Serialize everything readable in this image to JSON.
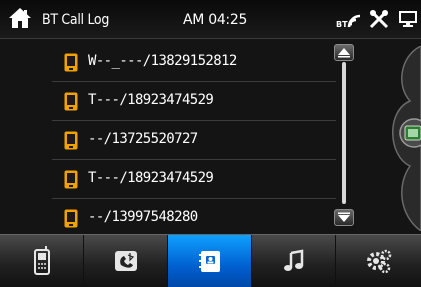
{
  "header": {
    "title": "BT Call Log",
    "time": "AM 04:25",
    "icons": [
      "home-icon",
      "bluetooth-signal-icon",
      "settings-tools-icon",
      "display-icon"
    ]
  },
  "calls": [
    {
      "number": "W--_---/13829152812"
    },
    {
      "number": "T---/18923474529"
    },
    {
      "number": "--/13725520727"
    },
    {
      "number": "T---/18923474529"
    },
    {
      "number": "--/13997548280"
    }
  ],
  "scroll": {
    "icons": [
      "scroll-up-icon",
      "scroll-down-icon"
    ]
  },
  "bottom_nav": {
    "tabs": [
      {
        "icon": "phone-icon"
      },
      {
        "icon": "bluetooth-phone-icon"
      },
      {
        "icon": "call-log-icon",
        "active": true
      },
      {
        "icon": "music-icon"
      },
      {
        "icon": "settings-icon"
      }
    ]
  },
  "colors": {
    "accent": "#0a88f0",
    "phone_icon": "#f2a100",
    "background": "#141414"
  }
}
